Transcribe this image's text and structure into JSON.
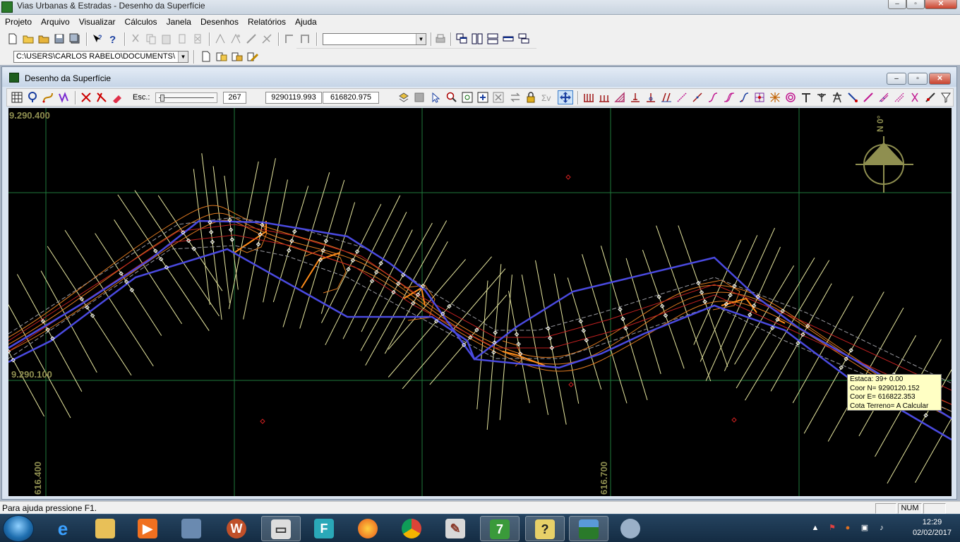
{
  "app": {
    "title": "Vias Urbanas & Estradas -  Desenho da Superfície"
  },
  "menu": [
    "Projeto",
    "Arquivo",
    "Visualizar",
    "Cálculos",
    "Janela",
    "Desenhos",
    "Relatórios",
    "Ajuda"
  ],
  "path_combo": {
    "value": "C:\\USERS\\CARLOS RABELO\\DOCUMENTS\\"
  },
  "child": {
    "title": "Desenho da Superfície",
    "scale_label": "Esc.:",
    "scale_value": "267",
    "coord_n": "9290119.993",
    "coord_e": "616820.975"
  },
  "grid_labels": {
    "n_top": "9.290.400",
    "n_bottom": "9.290.100",
    "e_left": "616.400",
    "e_right": "616.700"
  },
  "north_arrow": {
    "label": "N 0°"
  },
  "tooltip": {
    "line1": "Estaca:    39+ 0.00",
    "line2": "Coor N= 9290120.152",
    "line3": "Coor E= 616822.353",
    "line4": "Cota Terreno=  A Calcular"
  },
  "status": {
    "help": "Para ajuda pressione F1.",
    "num": "NUM"
  },
  "clock": {
    "time": "12:29",
    "date": "02/02/2017"
  },
  "taskbar_apps": [
    "internet-explorer",
    "file-explorer",
    "media-player",
    "network",
    "winamp",
    "video",
    "fl-studio",
    "firefox",
    "chrome",
    "editor",
    "app-7",
    "help",
    "vias-urbanas",
    "paint"
  ],
  "colors": {
    "canvas_bg": "#000000",
    "grid": "#1f7a3c",
    "alignment": "#4a4ae0",
    "sections": "#e8e8a0",
    "contours": "#e07a20"
  }
}
